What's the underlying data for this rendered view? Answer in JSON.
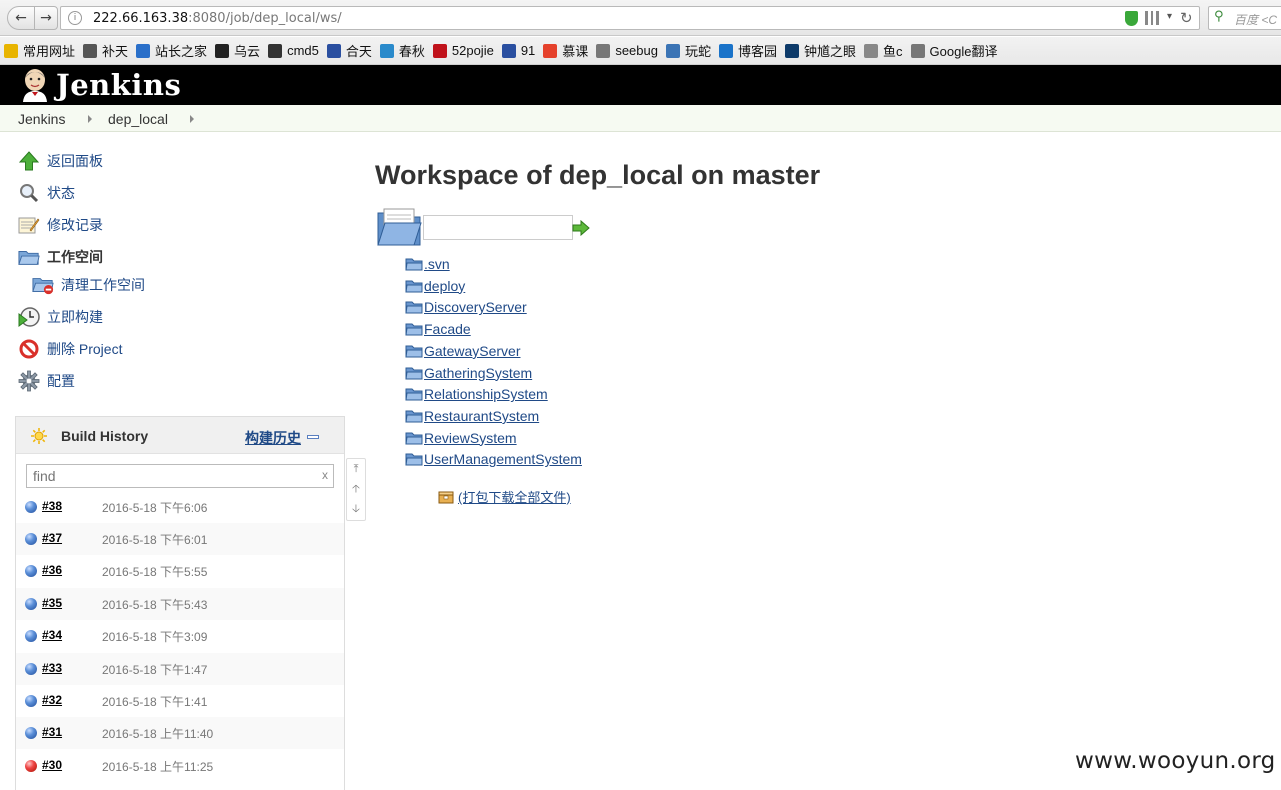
{
  "browser": {
    "url_host": "222.66.163.38",
    "url_rest": ":8080/job/dep_local/ws/",
    "search_placeholder": "百度 <C",
    "bookmarks": [
      {
        "label": "常用网址",
        "color": "#e8b400"
      },
      {
        "label": "补天",
        "color": "#555555"
      },
      {
        "label": "站长之家",
        "color": "#2a6fc9"
      },
      {
        "label": "乌云",
        "color": "#222222"
      },
      {
        "label": "cmd5",
        "color": "#333333"
      },
      {
        "label": "合天",
        "color": "#2a4fa0"
      },
      {
        "label": "春秋",
        "color": "#2a8acb"
      },
      {
        "label": "52pojie",
        "color": "#c0121b"
      },
      {
        "label": "91",
        "color": "#2a4fa0"
      },
      {
        "label": "慕课",
        "color": "#e5412b"
      },
      {
        "label": "seebug",
        "color": "#777777"
      },
      {
        "label": "玩蛇",
        "color": "#3b74b5"
      },
      {
        "label": "博客园",
        "color": "#1a73c9"
      },
      {
        "label": "钟馗之眼",
        "color": "#0d3a69"
      },
      {
        "label": "鱼c",
        "color": "#888888"
      },
      {
        "label": "Google翻译",
        "color": "#777777"
      }
    ]
  },
  "header": {
    "logo_text": "Jenkins"
  },
  "breadcrumb": [
    "Jenkins",
    "dep_local"
  ],
  "tasks": [
    {
      "label": "返回面板",
      "icon": "up-arrow-icon"
    },
    {
      "label": "状态",
      "icon": "magnifier-icon"
    },
    {
      "label": "修改记录",
      "icon": "notepad-icon"
    },
    {
      "label": "工作空间",
      "icon": "folder-icon"
    },
    {
      "label": "清理工作空间",
      "icon": "folder-delete-icon"
    },
    {
      "label": "立即构建",
      "icon": "clock-play-icon"
    },
    {
      "label": "删除 Project",
      "icon": "no-entry-icon"
    },
    {
      "label": "配置",
      "icon": "gear-icon"
    }
  ],
  "build_history": {
    "title": "Build History",
    "trend_label": "构建历史",
    "search_placeholder": "find",
    "clear": "x",
    "builds": [
      {
        "num": "#38",
        "date": "2016-5-18 下午6:06",
        "status": "blue"
      },
      {
        "num": "#37",
        "date": "2016-5-18 下午6:01",
        "status": "blue"
      },
      {
        "num": "#36",
        "date": "2016-5-18 下午5:55",
        "status": "blue"
      },
      {
        "num": "#35",
        "date": "2016-5-18 下午5:43",
        "status": "blue"
      },
      {
        "num": "#34",
        "date": "2016-5-18 下午3:09",
        "status": "blue"
      },
      {
        "num": "#33",
        "date": "2016-5-18 下午1:47",
        "status": "blue"
      },
      {
        "num": "#32",
        "date": "2016-5-18 下午1:41",
        "status": "blue"
      },
      {
        "num": "#31",
        "date": "2016-5-18 上午11:40",
        "status": "blue"
      },
      {
        "num": "#30",
        "date": "2016-5-18 上午11:25",
        "status": "red"
      }
    ]
  },
  "main": {
    "title": "Workspace of dep_local on master",
    "directories": [
      ".svn",
      "deploy",
      "DiscoveryServer",
      "Facade",
      "GatewayServer",
      "GatheringSystem",
      "RelationshipSystem",
      "RestaurantSystem",
      "ReviewSystem",
      "UserManagementSystem"
    ],
    "download_all": "(打包下载全部文件)"
  },
  "watermark": "www.wooyun.org"
}
